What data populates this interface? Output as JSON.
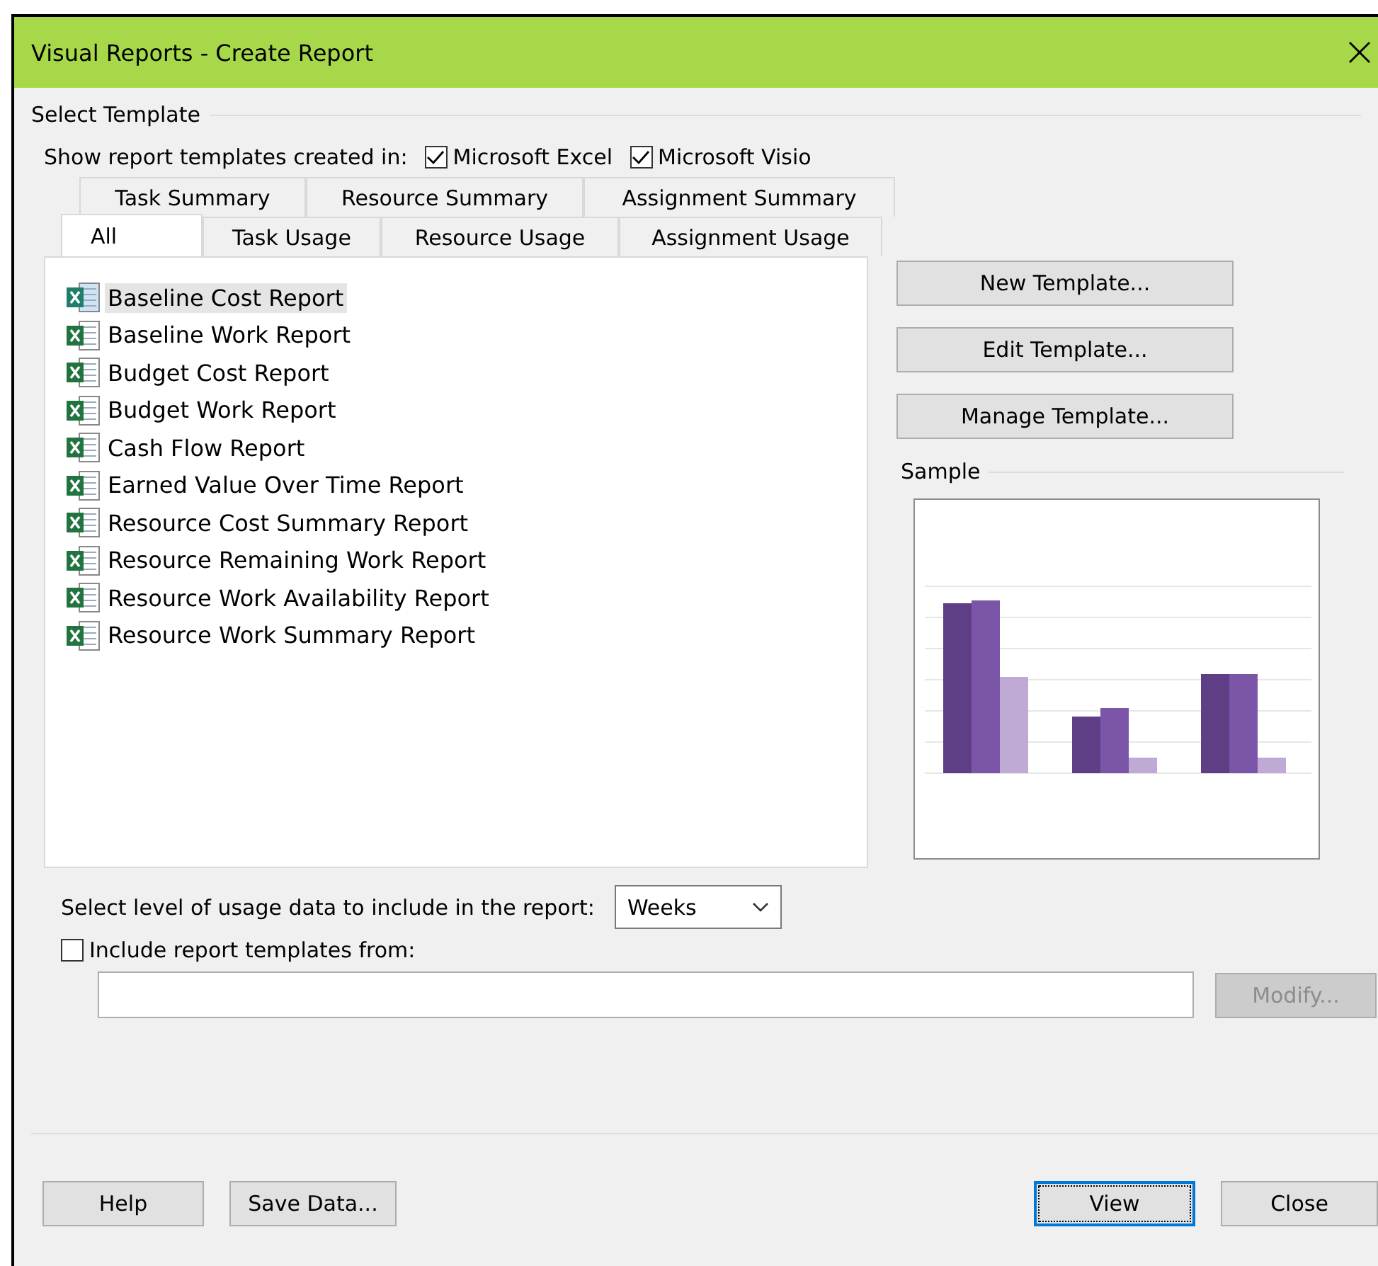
{
  "window": {
    "title": "Visual Reports - Create Report"
  },
  "group_title": "Select Template",
  "show_in": {
    "label": "Show report templates created in:",
    "options": [
      {
        "label": "Microsoft Excel",
        "checked": true
      },
      {
        "label": "Microsoft Visio",
        "checked": true
      }
    ]
  },
  "tabs": {
    "back_row": [
      {
        "label": "Task Summary",
        "selected": false
      },
      {
        "label": "Resource Summary",
        "selected": false
      },
      {
        "label": "Assignment Summary",
        "selected": false
      }
    ],
    "front_row": [
      {
        "label": "All",
        "selected": true
      },
      {
        "label": "Task Usage",
        "selected": false
      },
      {
        "label": "Resource Usage",
        "selected": false
      },
      {
        "label": "Assignment Usage",
        "selected": false
      }
    ]
  },
  "templates": [
    {
      "name": "Baseline Cost Report",
      "selected": true
    },
    {
      "name": "Baseline Work Report",
      "selected": false
    },
    {
      "name": "Budget Cost Report",
      "selected": false
    },
    {
      "name": "Budget Work Report",
      "selected": false
    },
    {
      "name": "Cash Flow Report",
      "selected": false
    },
    {
      "name": "Earned Value Over Time Report",
      "selected": false
    },
    {
      "name": "Resource Cost Summary Report",
      "selected": false
    },
    {
      "name": "Resource Remaining Work Report",
      "selected": false
    },
    {
      "name": "Resource Work Availability Report",
      "selected": false
    },
    {
      "name": "Resource Work Summary Report",
      "selected": false
    }
  ],
  "template_buttons": [
    "New Template...",
    "Edit Template...",
    "Manage Template..."
  ],
  "sample": {
    "title": "Sample"
  },
  "usage": {
    "label": "Select level of usage data to include in the report:",
    "value": "Weeks"
  },
  "include": {
    "label": "Include report templates from:",
    "checked": false,
    "button": {
      "label": "Modify...",
      "disabled": true
    }
  },
  "footer_left": [
    {
      "label": "Help",
      "focused": false
    },
    {
      "label": "Save Data...",
      "focused": false
    }
  ],
  "footer_right": [
    {
      "label": "View",
      "focused": true
    },
    {
      "label": "Close",
      "focused": false
    }
  ]
}
